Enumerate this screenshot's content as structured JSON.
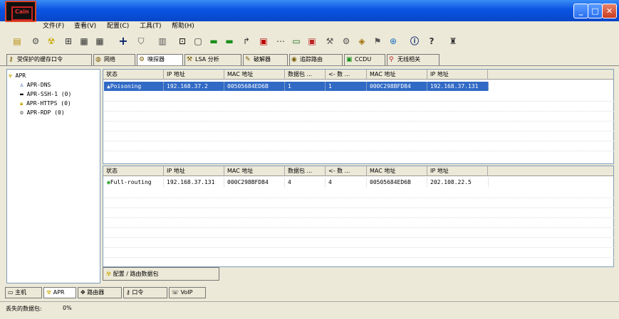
{
  "window": {
    "minimize_icon": "minimize-icon",
    "maximize_icon": "maximize-icon",
    "close_icon": "close-icon",
    "logo_text": "Cain"
  },
  "menu": [
    "文件(F)",
    "查看(V)",
    "配置(C)",
    "工具(T)",
    "帮助(H)"
  ],
  "toolbar_icons": [
    "folder-icon",
    "network-icon",
    "hazard-icon",
    "hosts-icon",
    "grid-icon",
    "grid2-icon",
    "plus-icon",
    "shield-icon",
    "book-icon",
    "route-icon",
    "doc-icon",
    "card-green-icon",
    "card-green2-icon",
    "arrow-icon",
    "pc-icon",
    "dots-icon",
    "monitor-icon",
    "chip-icon",
    "wrench-icon",
    "gear-icon",
    "cube-icon",
    "tool-icon",
    "network2-icon",
    "info-icon",
    "question-icon",
    "ladder-icon"
  ],
  "tabs": [
    {
      "label": "受保护的缓存口令",
      "icon": "key-icon"
    },
    {
      "label": "网络",
      "icon": "globe-icon"
    },
    {
      "label": "嗅探器",
      "icon": "sniffer-icon"
    },
    {
      "label": "LSA 分析",
      "icon": "lsa-icon"
    },
    {
      "label": "破解器",
      "icon": "cracker-icon"
    },
    {
      "label": "追踪路由",
      "icon": "traceroute-icon"
    },
    {
      "label": "CCDU",
      "icon": "ccdu-icon"
    },
    {
      "label": "无线相关",
      "icon": "wireless-icon"
    }
  ],
  "tree": [
    {
      "label": "APR",
      "icon": "hazard-icon"
    },
    {
      "label": "APR-DNS",
      "icon": "dns-icon"
    },
    {
      "label": "APR-SSH-1 (0)",
      "icon": "ssh-icon"
    },
    {
      "label": "APR-HTTPS (0)",
      "icon": "lock-icon"
    },
    {
      "label": "APR-RDP (0)",
      "icon": "rdp-icon"
    }
  ],
  "table_columns": [
    "状态",
    "IP 地址",
    "MAC 地址",
    "数据包 ...",
    "<- 数 ...",
    "MAC 地址",
    "IP 地址"
  ],
  "top_rows": [
    [
      "Poisoning",
      "192.168.37.2",
      "00505684ED6B",
      "1",
      "1",
      "000C298BFD84",
      "192.168.37.131"
    ]
  ],
  "bottom_rows": [
    [
      "Full-routing",
      "192.168.37.131",
      "000C298BFD84",
      "4",
      "4",
      "00505684ED6B",
      "202.108.22.5"
    ]
  ],
  "config_tab": "配置 / 路由数据包",
  "bottom_tabs": [
    {
      "label": "主机",
      "icon": "host-icon"
    },
    {
      "label": "APR",
      "icon": "hazard-icon"
    },
    {
      "label": "路由器",
      "icon": "router-icon"
    },
    {
      "label": "口令",
      "icon": "password-icon"
    },
    {
      "label": "VoIP",
      "icon": "voip-icon"
    }
  ],
  "status": {
    "label": "丢失的数据包:",
    "value": "0%"
  },
  "colors": {
    "selected_row": "#316AC5",
    "title_blue": "#0A54E3",
    "hazard": "#E8C800"
  }
}
